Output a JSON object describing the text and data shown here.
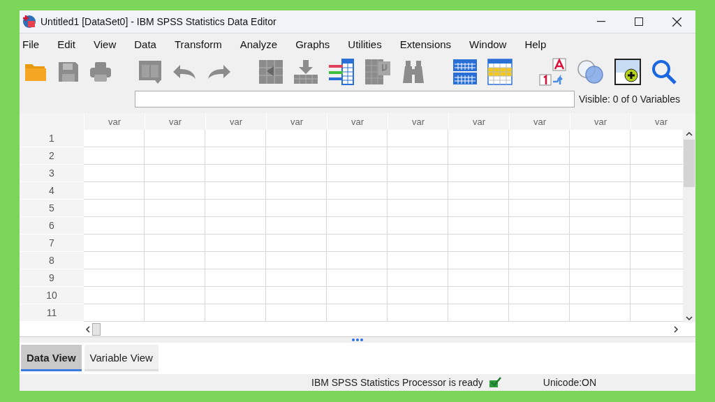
{
  "window": {
    "title": "Untitled1 [DataSet0] - IBM SPSS Statistics Data Editor"
  },
  "menu": [
    "File",
    "Edit",
    "View",
    "Data",
    "Transform",
    "Analyze",
    "Graphs",
    "Utilities",
    "Extensions",
    "Window",
    "Help"
  ],
  "toolbar": [
    {
      "kind": "open",
      "disabled": false
    },
    {
      "kind": "save",
      "disabled": true
    },
    {
      "kind": "print",
      "disabled": true
    },
    {
      "kind": "gap"
    },
    {
      "kind": "recall",
      "disabled": true
    },
    {
      "kind": "undo",
      "disabled": true
    },
    {
      "kind": "redo",
      "disabled": true
    },
    {
      "kind": "gap"
    },
    {
      "kind": "goto",
      "disabled": true
    },
    {
      "kind": "insert",
      "disabled": true
    },
    {
      "kind": "variables",
      "disabled": false
    },
    {
      "kind": "stats",
      "disabled": true
    },
    {
      "kind": "find",
      "disabled": true
    },
    {
      "kind": "gap"
    },
    {
      "kind": "cases",
      "disabled": false
    },
    {
      "kind": "vars",
      "disabled": false
    },
    {
      "kind": "gap"
    },
    {
      "kind": "labels",
      "disabled": false
    },
    {
      "kind": "sets",
      "disabled": false
    },
    {
      "kind": "showall",
      "disabled": false
    },
    {
      "kind": "search",
      "disabled": false
    }
  ],
  "cell_editor": {
    "visible_count": "Visible: 0 of 0 Variables"
  },
  "grid": {
    "columns": [
      "var",
      "var",
      "var",
      "var",
      "var",
      "var",
      "var",
      "var",
      "var",
      "var"
    ],
    "rows": [
      "1",
      "2",
      "3",
      "4",
      "5",
      "6",
      "7",
      "8",
      "9",
      "10",
      "11"
    ]
  },
  "tabs": [
    {
      "label": "Data View",
      "selected": true
    },
    {
      "label": "Variable View",
      "selected": false
    }
  ],
  "status_bar": {
    "message": "IBM SPSS Statistics Processor is ready",
    "encoding": "Unicode:ON"
  }
}
